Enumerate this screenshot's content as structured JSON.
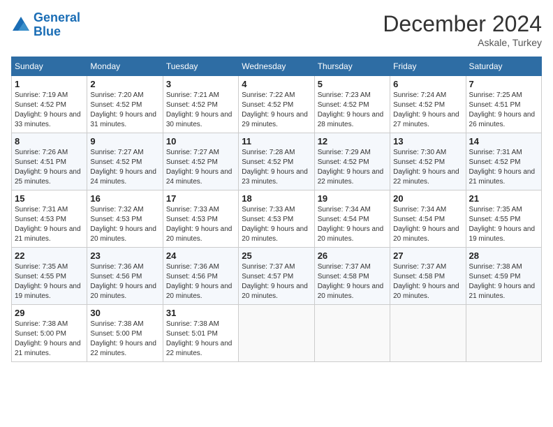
{
  "header": {
    "logo_line1": "General",
    "logo_line2": "Blue",
    "month": "December 2024",
    "location": "Askale, Turkey"
  },
  "weekdays": [
    "Sunday",
    "Monday",
    "Tuesday",
    "Wednesday",
    "Thursday",
    "Friday",
    "Saturday"
  ],
  "weeks": [
    [
      {
        "day": "1",
        "sunrise": "7:19 AM",
        "sunset": "4:52 PM",
        "daylight": "9 hours and 33 minutes."
      },
      {
        "day": "2",
        "sunrise": "7:20 AM",
        "sunset": "4:52 PM",
        "daylight": "9 hours and 31 minutes."
      },
      {
        "day": "3",
        "sunrise": "7:21 AM",
        "sunset": "4:52 PM",
        "daylight": "9 hours and 30 minutes."
      },
      {
        "day": "4",
        "sunrise": "7:22 AM",
        "sunset": "4:52 PM",
        "daylight": "9 hours and 29 minutes."
      },
      {
        "day": "5",
        "sunrise": "7:23 AM",
        "sunset": "4:52 PM",
        "daylight": "9 hours and 28 minutes."
      },
      {
        "day": "6",
        "sunrise": "7:24 AM",
        "sunset": "4:52 PM",
        "daylight": "9 hours and 27 minutes."
      },
      {
        "day": "7",
        "sunrise": "7:25 AM",
        "sunset": "4:51 PM",
        "daylight": "9 hours and 26 minutes."
      }
    ],
    [
      {
        "day": "8",
        "sunrise": "7:26 AM",
        "sunset": "4:51 PM",
        "daylight": "9 hours and 25 minutes."
      },
      {
        "day": "9",
        "sunrise": "7:27 AM",
        "sunset": "4:52 PM",
        "daylight": "9 hours and 24 minutes."
      },
      {
        "day": "10",
        "sunrise": "7:27 AM",
        "sunset": "4:52 PM",
        "daylight": "9 hours and 24 minutes."
      },
      {
        "day": "11",
        "sunrise": "7:28 AM",
        "sunset": "4:52 PM",
        "daylight": "9 hours and 23 minutes."
      },
      {
        "day": "12",
        "sunrise": "7:29 AM",
        "sunset": "4:52 PM",
        "daylight": "9 hours and 22 minutes."
      },
      {
        "day": "13",
        "sunrise": "7:30 AM",
        "sunset": "4:52 PM",
        "daylight": "9 hours and 22 minutes."
      },
      {
        "day": "14",
        "sunrise": "7:31 AM",
        "sunset": "4:52 PM",
        "daylight": "9 hours and 21 minutes."
      }
    ],
    [
      {
        "day": "15",
        "sunrise": "7:31 AM",
        "sunset": "4:53 PM",
        "daylight": "9 hours and 21 minutes."
      },
      {
        "day": "16",
        "sunrise": "7:32 AM",
        "sunset": "4:53 PM",
        "daylight": "9 hours and 20 minutes."
      },
      {
        "day": "17",
        "sunrise": "7:33 AM",
        "sunset": "4:53 PM",
        "daylight": "9 hours and 20 minutes."
      },
      {
        "day": "18",
        "sunrise": "7:33 AM",
        "sunset": "4:53 PM",
        "daylight": "9 hours and 20 minutes."
      },
      {
        "day": "19",
        "sunrise": "7:34 AM",
        "sunset": "4:54 PM",
        "daylight": "9 hours and 20 minutes."
      },
      {
        "day": "20",
        "sunrise": "7:34 AM",
        "sunset": "4:54 PM",
        "daylight": "9 hours and 20 minutes."
      },
      {
        "day": "21",
        "sunrise": "7:35 AM",
        "sunset": "4:55 PM",
        "daylight": "9 hours and 19 minutes."
      }
    ],
    [
      {
        "day": "22",
        "sunrise": "7:35 AM",
        "sunset": "4:55 PM",
        "daylight": "9 hours and 19 minutes."
      },
      {
        "day": "23",
        "sunrise": "7:36 AM",
        "sunset": "4:56 PM",
        "daylight": "9 hours and 20 minutes."
      },
      {
        "day": "24",
        "sunrise": "7:36 AM",
        "sunset": "4:56 PM",
        "daylight": "9 hours and 20 minutes."
      },
      {
        "day": "25",
        "sunrise": "7:37 AM",
        "sunset": "4:57 PM",
        "daylight": "9 hours and 20 minutes."
      },
      {
        "day": "26",
        "sunrise": "7:37 AM",
        "sunset": "4:58 PM",
        "daylight": "9 hours and 20 minutes."
      },
      {
        "day": "27",
        "sunrise": "7:37 AM",
        "sunset": "4:58 PM",
        "daylight": "9 hours and 20 minutes."
      },
      {
        "day": "28",
        "sunrise": "7:38 AM",
        "sunset": "4:59 PM",
        "daylight": "9 hours and 21 minutes."
      }
    ],
    [
      {
        "day": "29",
        "sunrise": "7:38 AM",
        "sunset": "5:00 PM",
        "daylight": "9 hours and 21 minutes."
      },
      {
        "day": "30",
        "sunrise": "7:38 AM",
        "sunset": "5:00 PM",
        "daylight": "9 hours and 22 minutes."
      },
      {
        "day": "31",
        "sunrise": "7:38 AM",
        "sunset": "5:01 PM",
        "daylight": "9 hours and 22 minutes."
      },
      null,
      null,
      null,
      null
    ]
  ]
}
